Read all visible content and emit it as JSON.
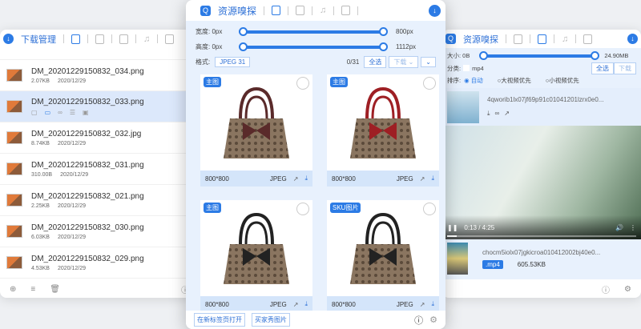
{
  "left": {
    "title": "下载管理",
    "items": [
      {
        "name": "DM_20201229150832_034.png",
        "size": "2.07KB",
        "date": "2020/12/29"
      },
      {
        "name": "DM_20201229150832_033.png",
        "selected": true
      },
      {
        "name": "DM_20201229150832_032.jpg",
        "size": "8.74KB",
        "date": "2020/12/29"
      },
      {
        "name": "DM_20201229150832_031.png",
        "size": "310.00B",
        "date": "2020/12/29"
      },
      {
        "name": "DM_20201229150832_021.png",
        "size": "2.25KB",
        "date": "2020/12/29"
      },
      {
        "name": "DM_20201229150832_030.png",
        "size": "6.03KB",
        "date": "2020/12/29"
      },
      {
        "name": "DM_20201229150832_029.png",
        "size": "4.53KB",
        "date": "2020/12/29"
      }
    ]
  },
  "center": {
    "title": "资源嗅探",
    "width_label": "宽度: 0px",
    "width_max": "800px",
    "height_label": "高度: 0px",
    "height_max": "1112px",
    "format_label": "格式:",
    "format_tag": "JPEG 31",
    "count": "0/31",
    "select_all": "全选",
    "download": "下载",
    "cards": [
      {
        "badge": "主图",
        "dims": "800*800",
        "fmt": "JPEG",
        "color": "#5a2a2a"
      },
      {
        "badge": "主图",
        "dims": "800*800",
        "fmt": "JPEG",
        "color": "#9e1f24"
      },
      {
        "badge": "主图",
        "dims": "800*800",
        "fmt": "JPEG",
        "color": "#222222"
      },
      {
        "badge": "SKU图片",
        "dims": "800*800",
        "fmt": "JPEG",
        "color": "#222222"
      }
    ],
    "open_new_tab": "在新标签页打开",
    "buyer_show": "买家秀图片"
  },
  "right": {
    "title": "资源嗅探",
    "size_label": "大小: 0B",
    "size_max": "24.90MB",
    "category_label": "分类:",
    "category_opt": "mp4",
    "select_all": "全选",
    "download": "下载",
    "sort_label": "排序:",
    "sort_opts": [
      "自动",
      "大视频优先",
      "小视频优先"
    ],
    "videos": [
      {
        "name": "4qworib1lx07jf69p91c01041201lzrx0e0..."
      },
      {
        "name": "chocm5iolx07jgkicroa010412002bj40e0...",
        "ext": ".mp4",
        "size": "605.53KB"
      }
    ],
    "player_time": "0:13 / 4:25",
    "progress": 0.05
  },
  "accent": "#2c7be5"
}
